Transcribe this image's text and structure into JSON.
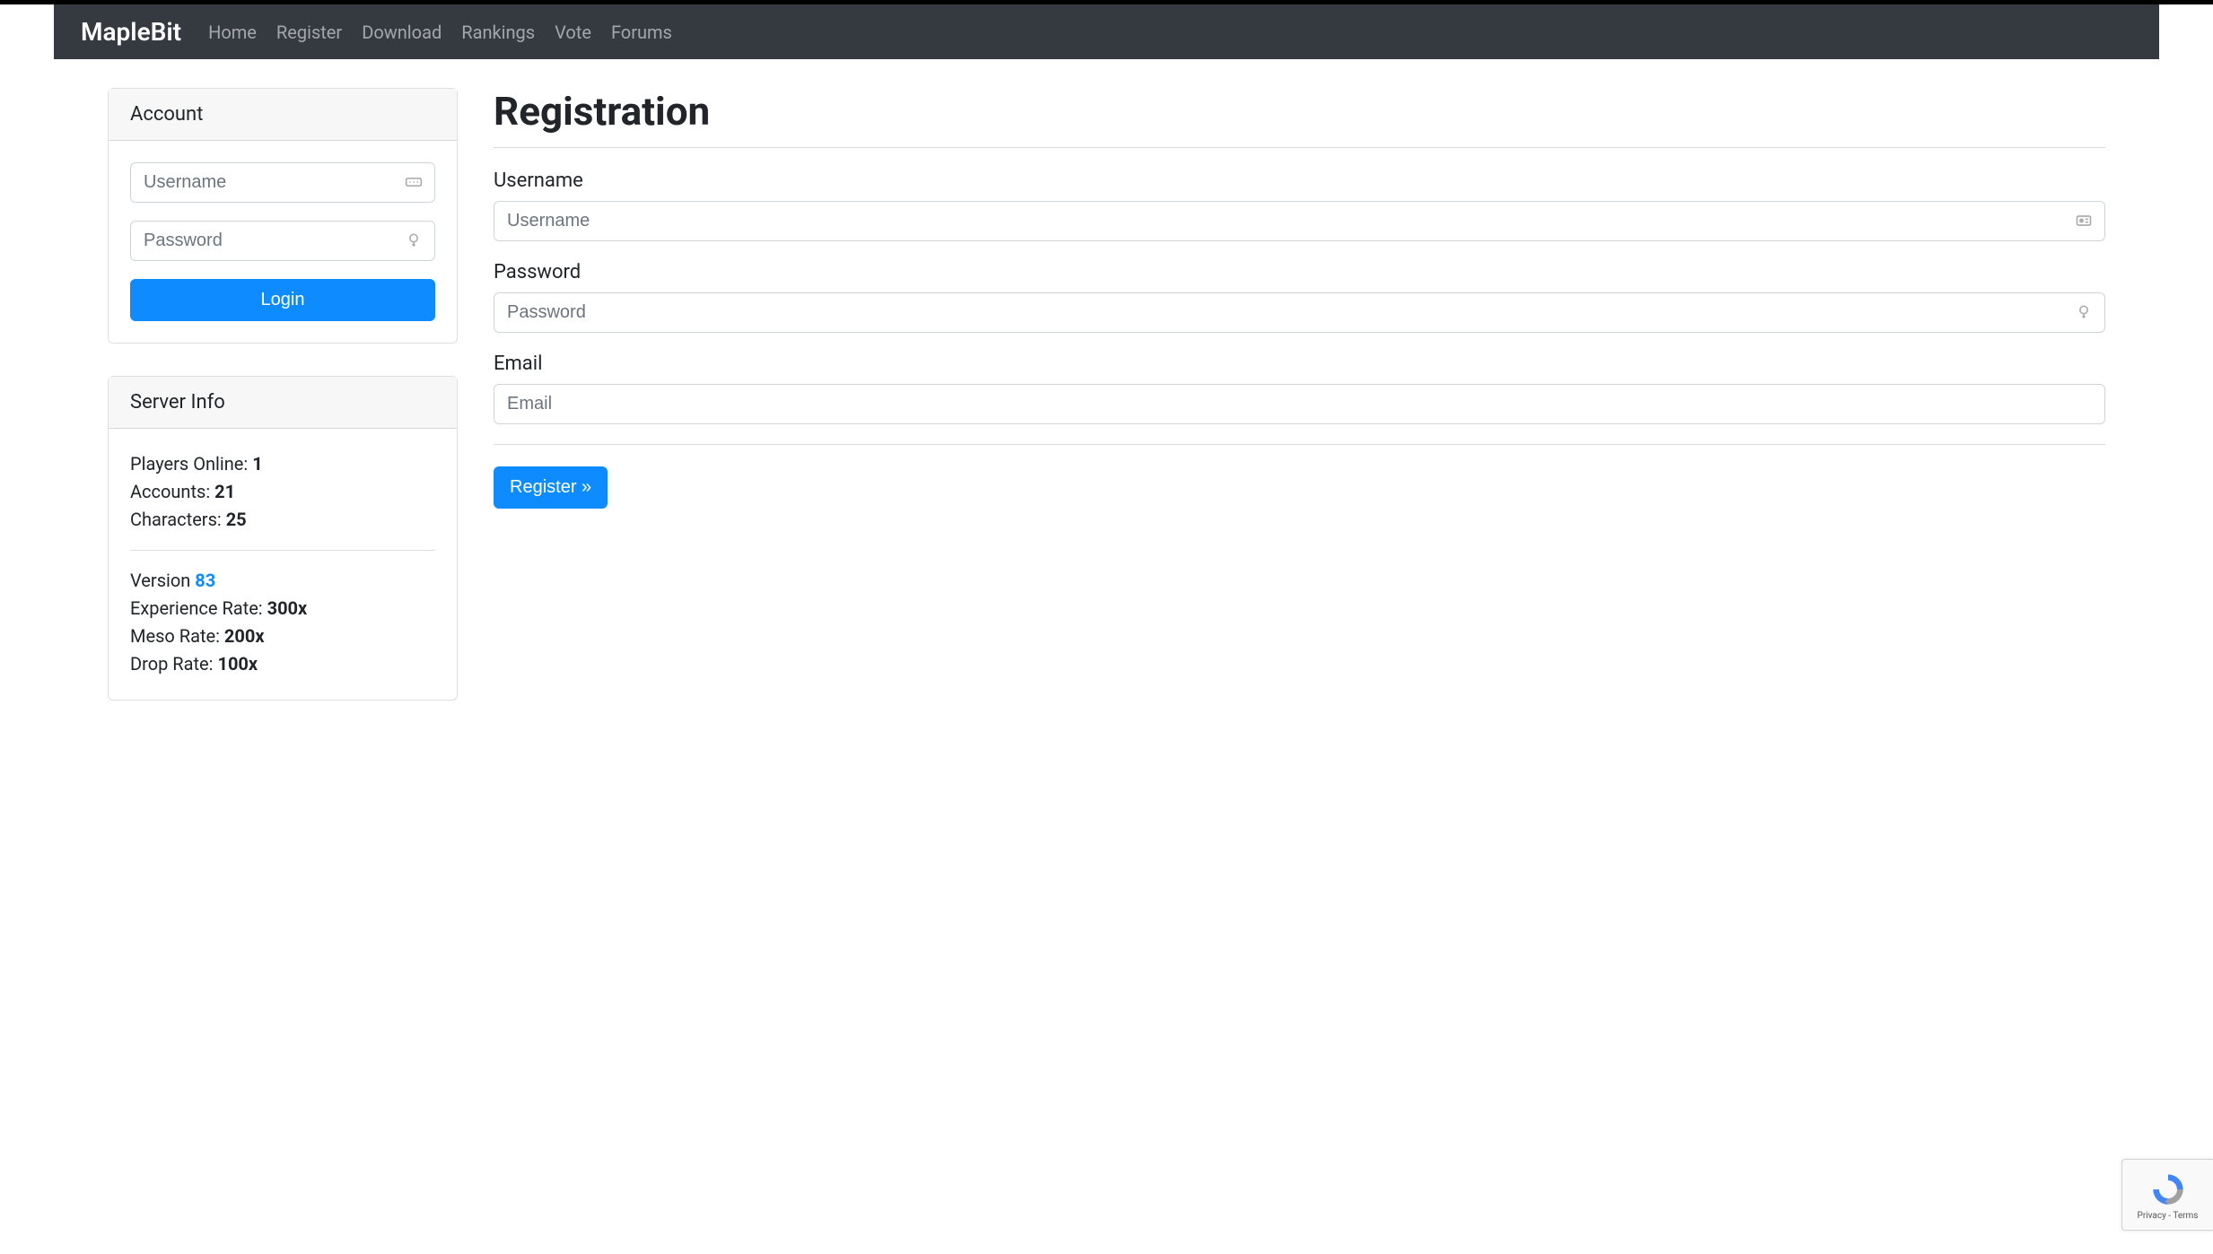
{
  "brand": "MapleBit",
  "nav": {
    "home": "Home",
    "register": "Register",
    "download": "Download",
    "rankings": "Rankings",
    "vote": "Vote",
    "forums": "Forums"
  },
  "sidebar": {
    "account": {
      "heading": "Account",
      "username_placeholder": "Username",
      "password_placeholder": "Password",
      "login_label": "Login"
    },
    "server_info": {
      "heading": "Server Info",
      "players_online_label": "Players Online: ",
      "players_online_value": "1",
      "accounts_label": "Accounts: ",
      "accounts_value": "21",
      "characters_label": "Characters: ",
      "characters_value": "25",
      "version_label": "Version ",
      "version_value": "83",
      "exp_rate_label": "Experience Rate: ",
      "exp_rate_value": "300x",
      "meso_rate_label": "Meso Rate: ",
      "meso_rate_value": "200x",
      "drop_rate_label": "Drop Rate: ",
      "drop_rate_value": "100x"
    }
  },
  "main": {
    "title": "Registration",
    "username_label": "Username",
    "username_placeholder": "Username",
    "password_label": "Password",
    "password_placeholder": "Password",
    "email_label": "Email",
    "email_placeholder": "Email",
    "register_button": "Register »"
  },
  "recaptcha": {
    "footer": "Privacy - Terms"
  }
}
